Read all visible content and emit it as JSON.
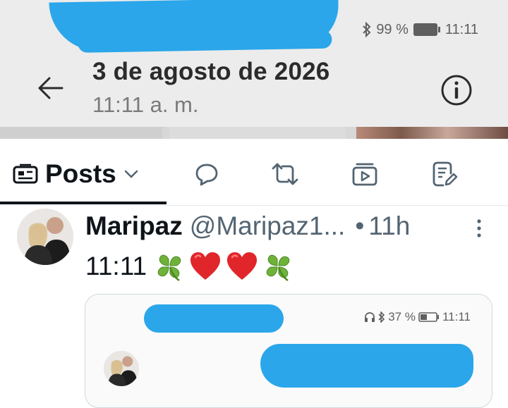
{
  "viewer": {
    "status_battery": "99 %",
    "status_time": "11:11",
    "title": "3 de agosto de 2026",
    "subtitle": "11:11 a. m.",
    "back_icon": "arrow-left-icon",
    "info_icon": "info-icon"
  },
  "tabs": {
    "posts_label": "Posts",
    "icons": [
      "posts-icon",
      "chevron-down-icon",
      "replies-icon",
      "retweet-icon",
      "media-icon",
      "articles-icon"
    ]
  },
  "tweet": {
    "author_name": "Maripaz",
    "author_handle": "@Maripaz1...",
    "separator": "•",
    "time": "11h",
    "text": "11:11",
    "emojis": [
      "four-leaf-clover",
      "red-heart",
      "red-heart",
      "four-leaf-clover"
    ]
  },
  "media": {
    "status_battery": "37 %",
    "status_time": "11:11"
  },
  "colors": {
    "scribble_blue": "#2ba6ea",
    "header_bg": "#ececec",
    "x_text": "#0f1419",
    "x_secondary": "#536471"
  }
}
